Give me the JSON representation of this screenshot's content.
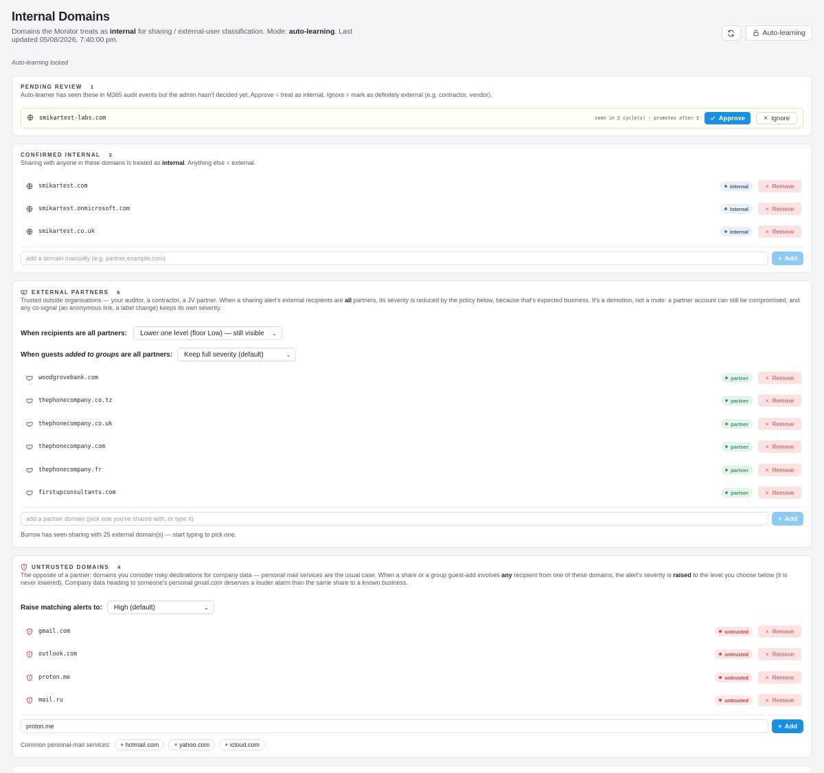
{
  "header": {
    "title": "Internal Domains",
    "subtitle_pre": "Domains the Monitor treats as ",
    "subtitle_bold1": "internal",
    "subtitle_mid": " for sharing / external-user classification. Mode: ",
    "subtitle_bold2": "auto-learning",
    "subtitle_post": ". Last updated 05/08/2026, 7:40:00 pm.",
    "refresh_icon": "refresh-icon",
    "auto_learning_label": "Auto-learning",
    "locked_note": "Auto-learning locked"
  },
  "pending": {
    "title": "PENDING REVIEW",
    "count": "1",
    "desc": "Auto-learner has seen these in M365 audit events but the admin hasn't decided yet. Approve = treat as internal. Ignore = mark as definitely external (e.g. contractor, vendor).",
    "items": [
      {
        "domain": "smikartest-labs.com",
        "meta": "seen in 2 cycle(s) · promotes after 3"
      }
    ],
    "approve_label": "Approve",
    "ignore_label": "Ignore"
  },
  "internal": {
    "title": "CONFIRMED INTERNAL",
    "count": "3",
    "desc_pre": "Sharing with anyone in these domains is treated as ",
    "desc_bold": "internal",
    "desc_post": ". Anything else = external.",
    "badge": "internal",
    "remove_label": "Remove",
    "items": [
      "smikartest.com",
      "smikartest.onmicrosoft.com",
      "smikartest.co.uk"
    ],
    "input_placeholder": "add a domain manually (e.g. partner.example.com)",
    "add_label": "Add"
  },
  "partners": {
    "title": "EXTERNAL PARTNERS",
    "count": "6",
    "desc_pre": "Trusted outside organisations — your auditor, a contractor, a JV partner. When a sharing alert's external recipients are ",
    "desc_bold": "all",
    "desc_post": " partners, its severity is reduced by the policy below, because that's expected business. It's a demotion, not a mute: a partner account can still be compromised, and any co-signal (an anonymous link, a label change) keeps its own severity.",
    "policy1_label": "When recipients are all partners:",
    "policy1_value": "Lower one level (floor Low) — still visible",
    "policy2_pre": "When guests ",
    "policy2_italic": "added to groups",
    "policy2_post": " are all partners:",
    "policy2_value": "Keep full severity (default)",
    "badge": "partner",
    "remove_label": "Remove",
    "items": [
      "woodgrovebank.com",
      "thephonecompany.co.tz",
      "thephonecompany.co.uk",
      "thephonecompany.com",
      "thephonecompany.fr",
      "firstupconsultants.com"
    ],
    "input_placeholder": "add a partner domain (pick one you've shared with, or type it)",
    "add_label": "Add",
    "hint": "Burrow has seen sharing with 25 external domain(s) — start typing to pick one."
  },
  "untrusted": {
    "title": "UNTRUSTED DOMAINS",
    "count": "4",
    "desc_pre": "The opposite of a partner: domains you consider risky destinations for company data — personal mail services are the usual case. When a share or a group guest-add involves ",
    "desc_bold1": "any",
    "desc_mid": " recipient from one of these domains, the alert's severity is ",
    "desc_bold2": "raised",
    "desc_mid2": " to the level you choose below (it is never lowered). Company data heading to someone's personal ",
    "desc_italic": "gmail.com",
    "desc_post": " deserves a louder alarm than the same share to a known business.",
    "raise_label": "Raise matching alerts to:",
    "raise_value": "High (default)",
    "badge": "untrusted",
    "remove_label": "Remove",
    "items": [
      "gmail.com",
      "outlook.com",
      "proton.me",
      "mail.ru"
    ],
    "input_value": "proton.me",
    "add_label": "Add",
    "chips_label": "Common personal-mail services:",
    "chips": [
      "+ hotmail.com",
      "+ yahoo.com",
      "+ icloud.com"
    ]
  },
  "colors": {
    "accent": "#1690e0",
    "danger": "#d3474c",
    "success": "#3f9a62"
  }
}
